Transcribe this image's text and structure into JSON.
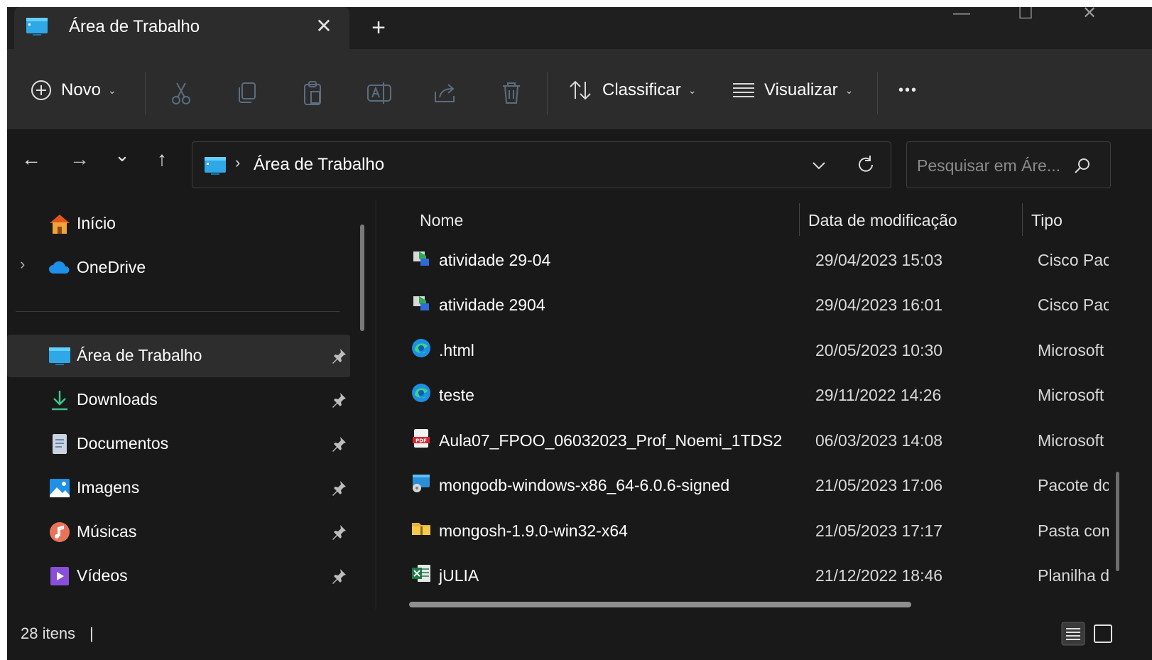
{
  "window": {
    "tab_title": "Área de Trabalho",
    "tab_close": "✕",
    "new_tab": "+",
    "controls": {
      "minimize": "—",
      "maximize": "☐",
      "close": "✕"
    }
  },
  "toolbar": {
    "new_label": "Novo",
    "sort_label": "Classificar",
    "view_label": "Visualizar",
    "more_label": "•••"
  },
  "nav": {
    "back": "←",
    "forward": "→",
    "recent": "⌄",
    "up": "↑",
    "address_sep": "›",
    "address": "Área de Trabalho",
    "search_placeholder": "Pesquisar em Áre..."
  },
  "sidebar": {
    "items": [
      {
        "label": "Início",
        "icon": "home-icon"
      },
      {
        "label": "OneDrive",
        "icon": "cloud-icon"
      },
      {
        "label": "Área de Trabalho",
        "icon": "desktop-icon",
        "pinned": true,
        "active": true
      },
      {
        "label": "Downloads",
        "icon": "download-icon",
        "pinned": true
      },
      {
        "label": "Documentos",
        "icon": "document-icon",
        "pinned": true
      },
      {
        "label": "Imagens",
        "icon": "image-icon",
        "pinned": true
      },
      {
        "label": "Músicas",
        "icon": "music-icon",
        "pinned": true
      },
      {
        "label": "Vídeos",
        "icon": "video-icon",
        "pinned": true
      }
    ]
  },
  "files": {
    "columns": [
      "Nome",
      "Data de modificação",
      "Tipo"
    ],
    "rows": [
      {
        "name": "atividade 29-04",
        "date": "29/04/2023 15:03",
        "type": "Cisco Pacl",
        "icon": "packet-tracer-icon"
      },
      {
        "name": "atividade 2904",
        "date": "29/04/2023 16:01",
        "type": "Cisco Pacl",
        "icon": "packet-tracer-icon"
      },
      {
        "name": ".html",
        "date": "20/05/2023 10:30",
        "type": "Microsoft",
        "icon": "edge-icon"
      },
      {
        "name": "teste",
        "date": "29/11/2022 14:26",
        "type": "Microsoft",
        "icon": "edge-icon"
      },
      {
        "name": "Aula07_FPOO_06032023_Prof_Noemi_1TDS2",
        "date": "06/03/2023 14:08",
        "type": "Microsoft",
        "icon": "pdf-icon"
      },
      {
        "name": "mongodb-windows-x86_64-6.0.6-signed",
        "date": "21/05/2023 17:06",
        "type": "Pacote dc",
        "icon": "installer-icon"
      },
      {
        "name": "mongosh-1.9.0-win32-x64",
        "date": "21/05/2023 17:17",
        "type": "Pasta com",
        "icon": "zip-folder-icon"
      },
      {
        "name": "jULIA",
        "date": "21/12/2022 18:46",
        "type": "Planilha d",
        "icon": "excel-icon"
      }
    ]
  },
  "status": {
    "count": "28 itens",
    "separator": "|"
  },
  "colors": {
    "background": "#191919",
    "toolbar": "#2c2c2c",
    "accent": "#4cc2ff"
  }
}
